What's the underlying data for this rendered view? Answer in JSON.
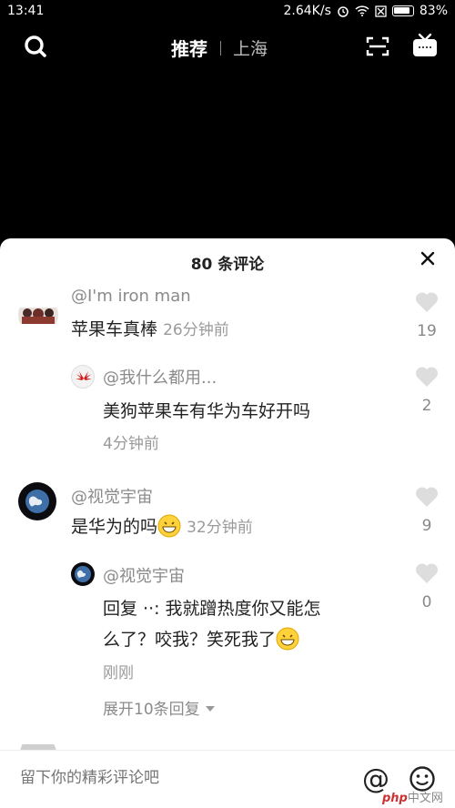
{
  "status_bar": {
    "time": "13:41",
    "speed": "2.64K/s",
    "battery": "83%"
  },
  "top_nav": {
    "tab_active": "推荐",
    "tab_location": "上海"
  },
  "comments_sheet": {
    "title": "80 条评论",
    "comments": [
      {
        "user": "@I'm iron man",
        "text": "苹果车真棒",
        "time": "26分钟前",
        "likes": "19"
      },
      {
        "user": "@我什么都用...",
        "text": "美狗苹果车有华为车好开吗",
        "time": "4分钟前",
        "likes": "2"
      },
      {
        "user": "@视觉宇宙",
        "text": "是华为的吗",
        "time": "32分钟前",
        "likes": "9"
      },
      {
        "user": "@视觉宇宙",
        "text_line1": "回复 ··: 我就蹭热度你又能怎",
        "text_line2": "么了？咬我？笑死我了",
        "time": "刚刚",
        "likes": "0"
      }
    ],
    "expand_replies": "展开10条回复"
  },
  "input_bar": {
    "placeholder": "留下你的精彩评论吧",
    "at_symbol": "@"
  },
  "watermark": {
    "brand": "php",
    "site": "中文网"
  },
  "colors": {
    "background": "#000000",
    "sheet": "#ffffff",
    "text_primary": "#222222",
    "text_secondary": "#8a8a8a"
  }
}
